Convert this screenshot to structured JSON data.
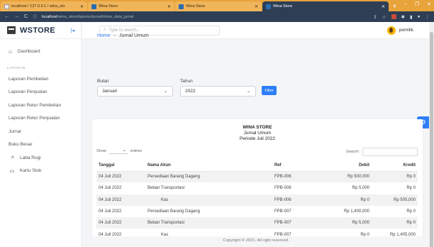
{
  "browser": {
    "tabs": [
      {
        "label": "localhost / 127.0.0.1 / wina_sto",
        "active": false
      },
      {
        "label": "Wina Store",
        "active": false
      },
      {
        "label": "Wina Store",
        "active": false
      },
      {
        "label": "Wina Store",
        "active": true
      }
    ],
    "url_host": "localhost",
    "url_path": "/wina_store/laporan/jurnal/show_data_jurnal",
    "colors": {
      "tabbar": "#e8a33a",
      "addressbar": "#2d3e55"
    }
  },
  "sidebar": {
    "brand": "WSTORE",
    "dashboard": "Dashboard",
    "section": "LAPORAN",
    "items": [
      "Laporan Pembelian",
      "Laporan Penjualan",
      "Laporan Retur Pembelian",
      "Laporan Retur Penjualan",
      "Jurnal",
      "Buku Besar"
    ],
    "laba_rugi": "Laba Rugi",
    "kartu_stok": "Kartu Stok"
  },
  "topbar": {
    "search_placeholder": "Type to search...",
    "username": "pemilik"
  },
  "breadcrumb": {
    "home": "Home",
    "current": "Jurnal Umum"
  },
  "filter": {
    "bulan_label": "Bulan",
    "bulan_value": "Januari",
    "tahun_label": "Tahun",
    "tahun_value": "2022",
    "button": "Filter"
  },
  "report": {
    "store": "WINA STORE",
    "title": "Jurnal Umum",
    "period": "Periode Juli 2022",
    "show_label": "Show",
    "entries_label": "entries",
    "search_label": "Search:",
    "columns": [
      "Tanggal",
      "Nama Akun",
      "Ref",
      "Debit",
      "Kredit"
    ],
    "rows": [
      {
        "tanggal": "04 Juli 2022",
        "akun": "Persediaan Barang Dagang",
        "ref": "FPB-006",
        "debit": "Rp 500,000",
        "kredit": "Rp 0"
      },
      {
        "tanggal": "04 Juli 2022",
        "akun": "Beban Transportasi",
        "ref": "FPB-006",
        "debit": "Rp 5,000",
        "kredit": "Rp 0"
      },
      {
        "tanggal": "04 Juli 2022",
        "akun": "Kas",
        "ref": "FPB-006",
        "debit": "Rp 0",
        "kredit": "Rp 505,000"
      },
      {
        "tanggal": "04 Juli 2022",
        "akun": "Persediaan Barang Dagang",
        "ref": "FPB-007",
        "debit": "Rp 1,400,000",
        "kredit": "Rp 0"
      },
      {
        "tanggal": "04 Juli 2022",
        "akun": "Beban Transportasi",
        "ref": "FPB-007",
        "debit": "Rp 5,000",
        "kredit": "Rp 0"
      },
      {
        "tanggal": "04 Juli 2022",
        "akun": "Kas",
        "ref": "FPB-007",
        "debit": "Rp 0",
        "kredit": "Rp 1,405,000"
      }
    ]
  },
  "footer": "Copyright © 2021. All right reserved."
}
